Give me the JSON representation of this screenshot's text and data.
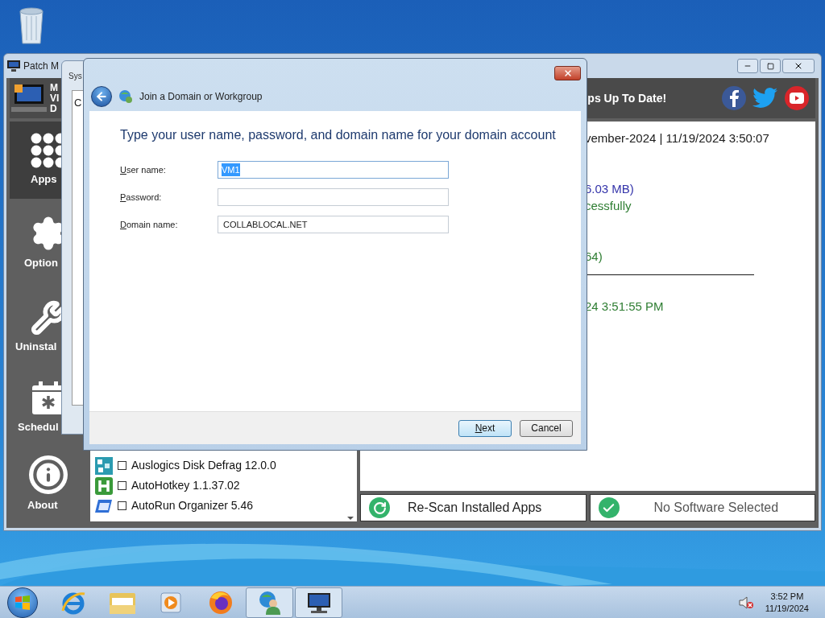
{
  "app_window": {
    "title": "Patch M",
    "logo_lines": [
      "M",
      "VI",
      "D"
    ],
    "banner": "ps Up To Date!",
    "sidebar": [
      {
        "label": "Apps",
        "kind": "apps",
        "selected": true
      },
      {
        "label": "Option",
        "kind": "options",
        "selected": false
      },
      {
        "label": "Uninstal",
        "kind": "uninstall",
        "selected": false
      },
      {
        "label": "Schedul",
        "kind": "schedule",
        "selected": false
      },
      {
        "label": "About",
        "kind": "about",
        "selected": false
      }
    ],
    "log": [
      {
        "text": "vember-2024 | 11/19/2024 3:50:07",
        "color": "#1a1a1a"
      },
      {
        "text": "6.03 MB)",
        "color": "#3333aa"
      },
      {
        "text": "cessfully",
        "color": "#2e7d32"
      },
      {
        "text": "64)",
        "color": "#2e7d32"
      },
      {
        "text": "——————————————",
        "color": "#1a1a1a"
      },
      {
        "text": "24 3:51:55 PM",
        "color": "#2e7d32"
      }
    ],
    "software": [
      {
        "name": "Auslogics Disk Defrag 12.0.0",
        "kind": "tiles",
        "checked": false
      },
      {
        "name": "AutoHotkey 1.1.37.02",
        "kind": "hotkey",
        "checked": false
      },
      {
        "name": "AutoRun Organizer 5.46",
        "kind": "organizer",
        "checked": false
      }
    ],
    "buttons": [
      {
        "label": "Re-Scan Installed Apps",
        "kind": "rescan"
      },
      {
        "label": "No Software Selected",
        "kind": "status"
      }
    ]
  },
  "behind_window": {
    "title": "Sys",
    "content": "C"
  },
  "dialog": {
    "title": "Join a Domain or Workgroup",
    "heading": "Type your user name, password, and domain name for your domain account",
    "fields": [
      {
        "label": "User name:",
        "mnemonic": true,
        "value": "VM1",
        "selected": true
      },
      {
        "label": "Password:",
        "mnemonic": true,
        "selected": false
      },
      {
        "label": "Domain name:",
        "mnemonic": true,
        "value": "COLLABLOCAL.NET",
        "selected": false
      }
    ],
    "buttons": [
      {
        "label": "Next",
        "mnemonic": true,
        "default": true
      },
      {
        "label": "Cancel",
        "mnemonic": false,
        "default": false
      }
    ]
  },
  "taskbar": {
    "items": [
      {
        "kind": "browser",
        "active": false
      },
      {
        "kind": "folder",
        "active": false
      },
      {
        "kind": "media",
        "active": false
      },
      {
        "kind": "firefox",
        "active": false
      },
      {
        "kind": "network-user",
        "active": true
      },
      {
        "kind": "monitor",
        "active": true
      }
    ],
    "clock": {
      "time": "3:52 PM",
      "date": "11/19/2024"
    }
  }
}
